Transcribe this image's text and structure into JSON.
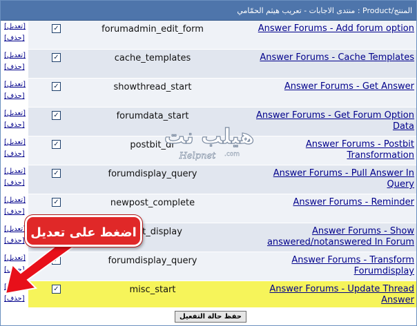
{
  "header": {
    "breadcrumb": "المنتج/Product : منتدى الاجابات - تعريب هيثم الحمّامي"
  },
  "row_actions": {
    "edit": "[تعديل]",
    "delete": "[حذف]"
  },
  "rows": [
    {
      "hook": "forumadmin_edit_form",
      "product": [
        "Answer Forums - Add forum option"
      ],
      "checked": true
    },
    {
      "hook": "cache_templates",
      "product": [
        "Answer Forums - Cache Templates"
      ],
      "checked": true
    },
    {
      "hook": "showthread_start",
      "product": [
        "Answer Forums - Get Answer"
      ],
      "checked": true
    },
    {
      "hook": "forumdata_start",
      "product": [
        "Answer Forums - Get Forum Option",
        "Data"
      ],
      "checked": true
    },
    {
      "hook": "postbit_dr",
      "product": [
        "Answer Forums - Postbit",
        "Transformation"
      ],
      "checked": true
    },
    {
      "hook": "forumdisplay_query",
      "product": [
        "Answer Forums - Pull Answer In",
        "Query"
      ],
      "checked": true
    },
    {
      "hook": "newpost_complete",
      "product": [
        "Answer Forums - Reminder"
      ],
      "checked": true
    },
    {
      "hook": "adbit_display",
      "product": [
        "Answer Forums - Show",
        "answered/notanswered In Forum"
      ],
      "checked": true
    },
    {
      "hook": "forumdisplay_query",
      "product": [
        "Answer Forums - Transform",
        "Forumdisplay"
      ],
      "checked": true
    },
    {
      "hook": "misc_start",
      "product": [
        "Answer Forums - Update Thread",
        "Answer"
      ],
      "checked": true,
      "highlighted": true
    }
  ],
  "footer": {
    "save_label": "حفظ حالة التفعيل"
  },
  "watermark": {
    "text": "هيلب نت",
    "latin": "Helpnet",
    "suffix": ".com"
  },
  "callout": {
    "text": "اضغط على تعديل"
  },
  "colors": {
    "header": "#4e75ab",
    "highlight": "#f6f45a",
    "link": "#00008b",
    "callout": "#e02828"
  }
}
